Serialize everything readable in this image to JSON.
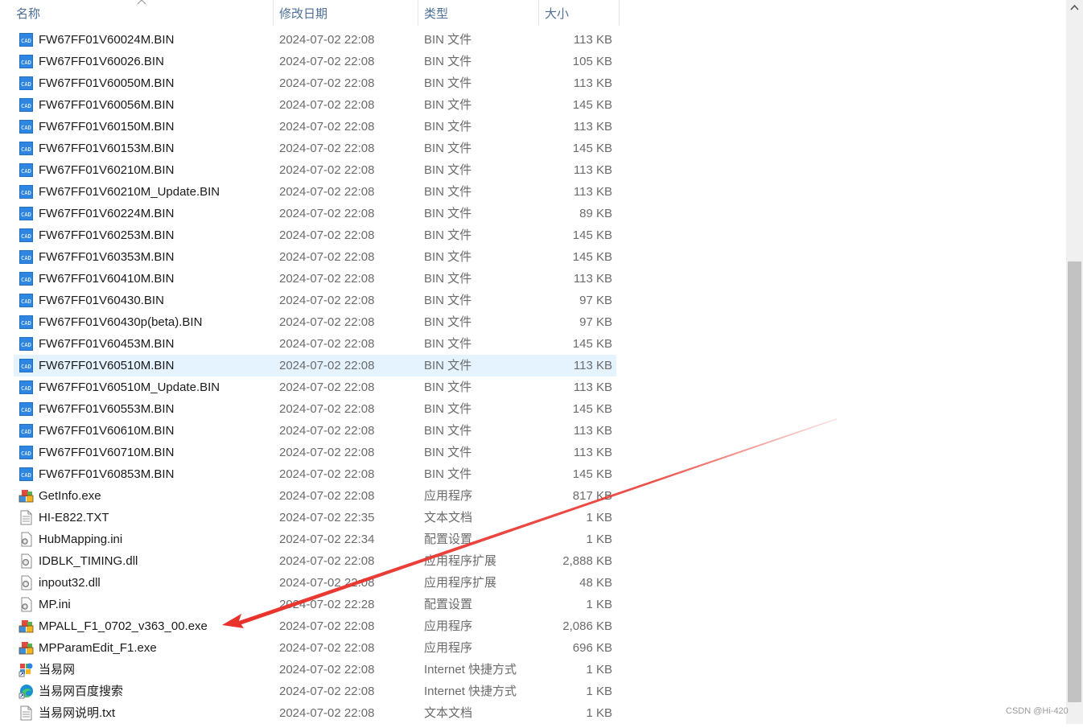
{
  "columns": {
    "name": "名称",
    "date": "修改日期",
    "type": "类型",
    "size": "大小"
  },
  "files": [
    {
      "name": "FW67FF01V60024M.BIN",
      "date": "2024-07-02 22:08",
      "type": "BIN 文件",
      "size": "113 KB",
      "icon": "cad-file-icon"
    },
    {
      "name": "FW67FF01V60026.BIN",
      "date": "2024-07-02 22:08",
      "type": "BIN 文件",
      "size": "105 KB",
      "icon": "cad-file-icon"
    },
    {
      "name": "FW67FF01V60050M.BIN",
      "date": "2024-07-02 22:08",
      "type": "BIN 文件",
      "size": "113 KB",
      "icon": "cad-file-icon"
    },
    {
      "name": "FW67FF01V60056M.BIN",
      "date": "2024-07-02 22:08",
      "type": "BIN 文件",
      "size": "145 KB",
      "icon": "cad-file-icon"
    },
    {
      "name": "FW67FF01V60150M.BIN",
      "date": "2024-07-02 22:08",
      "type": "BIN 文件",
      "size": "113 KB",
      "icon": "cad-file-icon"
    },
    {
      "name": "FW67FF01V60153M.BIN",
      "date": "2024-07-02 22:08",
      "type": "BIN 文件",
      "size": "145 KB",
      "icon": "cad-file-icon"
    },
    {
      "name": "FW67FF01V60210M.BIN",
      "date": "2024-07-02 22:08",
      "type": "BIN 文件",
      "size": "113 KB",
      "icon": "cad-file-icon"
    },
    {
      "name": "FW67FF01V60210M_Update.BIN",
      "date": "2024-07-02 22:08",
      "type": "BIN 文件",
      "size": "113 KB",
      "icon": "cad-file-icon"
    },
    {
      "name": "FW67FF01V60224M.BIN",
      "date": "2024-07-02 22:08",
      "type": "BIN 文件",
      "size": "89 KB",
      "icon": "cad-file-icon"
    },
    {
      "name": "FW67FF01V60253M.BIN",
      "date": "2024-07-02 22:08",
      "type": "BIN 文件",
      "size": "145 KB",
      "icon": "cad-file-icon"
    },
    {
      "name": "FW67FF01V60353M.BIN",
      "date": "2024-07-02 22:08",
      "type": "BIN 文件",
      "size": "145 KB",
      "icon": "cad-file-icon"
    },
    {
      "name": "FW67FF01V60410M.BIN",
      "date": "2024-07-02 22:08",
      "type": "BIN 文件",
      "size": "113 KB",
      "icon": "cad-file-icon"
    },
    {
      "name": "FW67FF01V60430.BIN",
      "date": "2024-07-02 22:08",
      "type": "BIN 文件",
      "size": "97 KB",
      "icon": "cad-file-icon"
    },
    {
      "name": "FW67FF01V60430p(beta).BIN",
      "date": "2024-07-02 22:08",
      "type": "BIN 文件",
      "size": "97 KB",
      "icon": "cad-file-icon"
    },
    {
      "name": "FW67FF01V60453M.BIN",
      "date": "2024-07-02 22:08",
      "type": "BIN 文件",
      "size": "145 KB",
      "icon": "cad-file-icon"
    },
    {
      "name": "FW67FF01V60510M.BIN",
      "date": "2024-07-02 22:08",
      "type": "BIN 文件",
      "size": "113 KB",
      "icon": "cad-file-icon",
      "selected": true
    },
    {
      "name": "FW67FF01V60510M_Update.BIN",
      "date": "2024-07-02 22:08",
      "type": "BIN 文件",
      "size": "113 KB",
      "icon": "cad-file-icon"
    },
    {
      "name": "FW67FF01V60553M.BIN",
      "date": "2024-07-02 22:08",
      "type": "BIN 文件",
      "size": "145 KB",
      "icon": "cad-file-icon"
    },
    {
      "name": "FW67FF01V60610M.BIN",
      "date": "2024-07-02 22:08",
      "type": "BIN 文件",
      "size": "113 KB",
      "icon": "cad-file-icon"
    },
    {
      "name": "FW67FF01V60710M.BIN",
      "date": "2024-07-02 22:08",
      "type": "BIN 文件",
      "size": "113 KB",
      "icon": "cad-file-icon"
    },
    {
      "name": "FW67FF01V60853M.BIN",
      "date": "2024-07-02 22:08",
      "type": "BIN 文件",
      "size": "145 KB",
      "icon": "cad-file-icon"
    },
    {
      "name": "GetInfo.exe",
      "date": "2024-07-02 22:08",
      "type": "应用程序",
      "size": "817 KB",
      "icon": "application-icon"
    },
    {
      "name": "HI-E822.TXT",
      "date": "2024-07-02 22:35",
      "type": "文本文档",
      "size": "1 KB",
      "icon": "text-document-icon"
    },
    {
      "name": "HubMapping.ini",
      "date": "2024-07-02 22:34",
      "type": "配置设置",
      "size": "1 KB",
      "icon": "config-settings-icon"
    },
    {
      "name": "IDBLK_TIMING.dll",
      "date": "2024-07-02 22:08",
      "type": "应用程序扩展",
      "size": "2,888 KB",
      "icon": "dll-extension-icon"
    },
    {
      "name": "inpout32.dll",
      "date": "2024-07-02 22:08",
      "type": "应用程序扩展",
      "size": "48 KB",
      "icon": "dll-extension-icon"
    },
    {
      "name": "MP.ini",
      "date": "2024-07-02 22:28",
      "type": "配置设置",
      "size": "1 KB",
      "icon": "config-settings-icon"
    },
    {
      "name": "MPALL_F1_0702_v363_00.exe",
      "date": "2024-07-02 22:08",
      "type": "应用程序",
      "size": "2,086 KB",
      "icon": "application-icon"
    },
    {
      "name": "MPParamEdit_F1.exe",
      "date": "2024-07-02 22:08",
      "type": "应用程序",
      "size": "696 KB",
      "icon": "application-icon"
    },
    {
      "name": "当易网",
      "date": "2024-07-02 22:08",
      "type": "Internet 快捷方式",
      "size": "1 KB",
      "icon": "internet-shortcut-icon"
    },
    {
      "name": "当易网百度搜索",
      "date": "2024-07-02 22:08",
      "type": "Internet 快捷方式",
      "size": "1 KB",
      "icon": "edge-shortcut-icon"
    },
    {
      "name": "当易网说明.txt",
      "date": "2024-07-02 22:08",
      "type": "文本文档",
      "size": "1 KB",
      "icon": "text-document-icon"
    }
  ],
  "colors": {
    "header_text": "#4d6f96",
    "selection": "#e5f3ff",
    "annotation_arrow": "#e8322b"
  },
  "watermark": "CSDN @Hi-420"
}
